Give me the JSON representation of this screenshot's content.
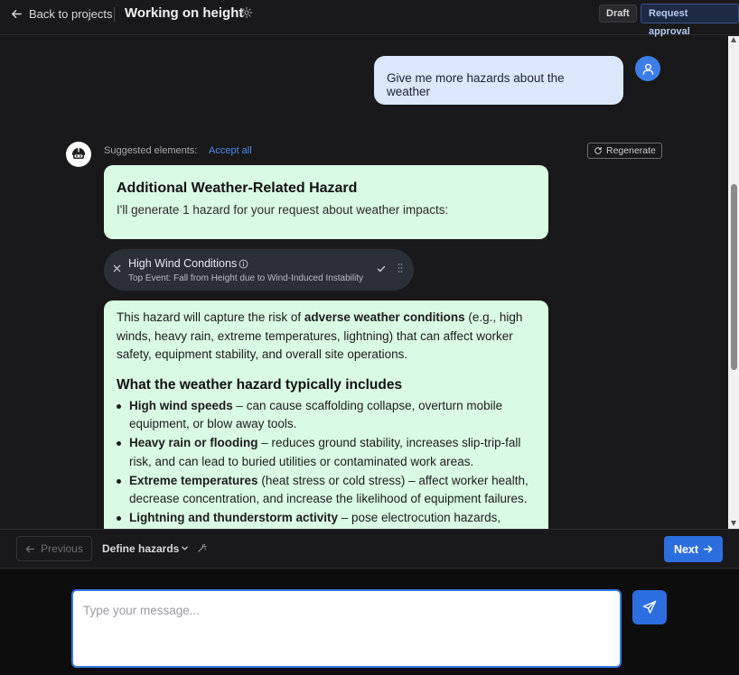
{
  "header": {
    "back_label": "Back to projects",
    "title": "Working on height",
    "status_badge": "Draft",
    "request_approval_label": "Request approval"
  },
  "chat": {
    "user_message": "Give me more hazards about the weather",
    "suggested_label": "Suggested elements:",
    "accept_all_label": "Accept all",
    "regenerate_label": "Regenerate",
    "intro_card": {
      "title": "Additional Weather-Related Hazard",
      "text": "I'll generate 1 hazard for your request about weather impacts:"
    },
    "hazard_chip": {
      "name": "High Wind Conditions",
      "top_event": "Top Event: Fall from Height due to Wind-Induced Instability"
    },
    "detail_card": {
      "intro_pre": "This hazard will capture the risk of ",
      "intro_bold": "adverse weather conditions",
      "intro_post": " (e.g., high winds, heavy rain, extreme temperatures, lightning) that can affect worker safety, equipment stability, and overall site operations.",
      "heading": "What the weather hazard typically includes",
      "items": [
        {
          "bold": "High wind speeds",
          "text": " – can cause scaffolding collapse, overturn mobile equipment, or blow away tools."
        },
        {
          "bold": "Heavy rain or flooding",
          "text": " – reduces ground stability, increases slip-trip-fall risk, and can lead to buried utilities or contaminated work areas."
        },
        {
          "bold": "Extreme temperatures",
          "text": " (heat stress or cold stress) – affect worker health, decrease concentration, and increase the likelihood of equipment failures."
        },
        {
          "bold": "Lightning and thunderstorm activity",
          "text": " – pose electrocution hazards,"
        }
      ]
    }
  },
  "stepbar": {
    "previous_label": "Previous",
    "current_step": "Define hazards",
    "next_label": "Next"
  },
  "composer": {
    "placeholder": "Type your message..."
  },
  "colors": {
    "accent": "#2c6ee0",
    "user_bubble": "#dbe7fb",
    "assistant_card": "#d9fbe3",
    "background": "#19191b"
  },
  "icons": [
    "arrow-left-icon",
    "gear-icon",
    "user-icon",
    "robot-icon",
    "refresh-icon",
    "close-icon",
    "info-icon",
    "check-icon",
    "drag-handle-icon",
    "chevron-down-icon",
    "magic-wand-icon",
    "arrow-right-icon",
    "send-icon"
  ]
}
